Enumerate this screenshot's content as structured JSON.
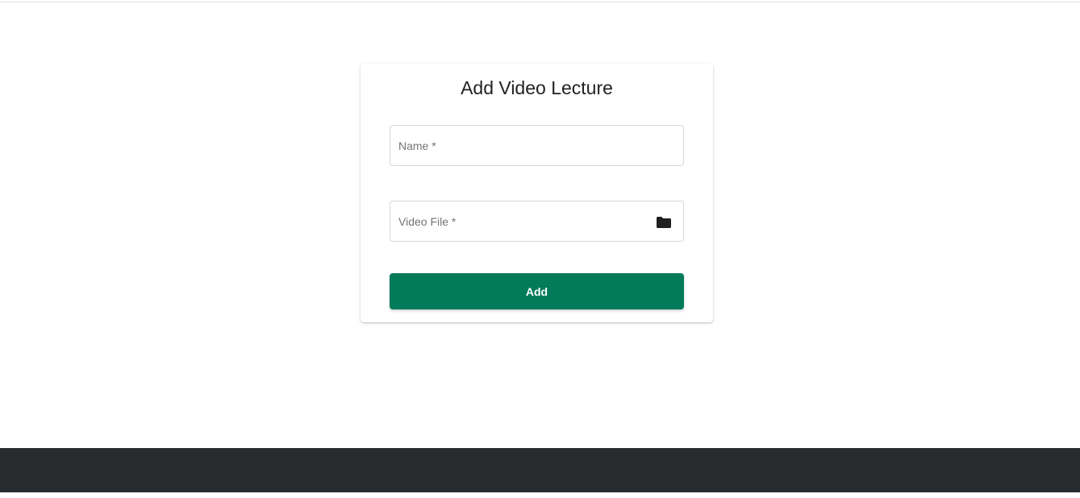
{
  "form": {
    "title": "Add Video Lecture",
    "name_placeholder": "Name *",
    "name_value": "",
    "video_placeholder": "Video File *",
    "video_value": "",
    "video_icon": "folder-icon",
    "submit_label": "Add"
  },
  "colors": {
    "accent": "#027b5b",
    "footer": "#292c2f",
    "background": "#ffffff"
  }
}
